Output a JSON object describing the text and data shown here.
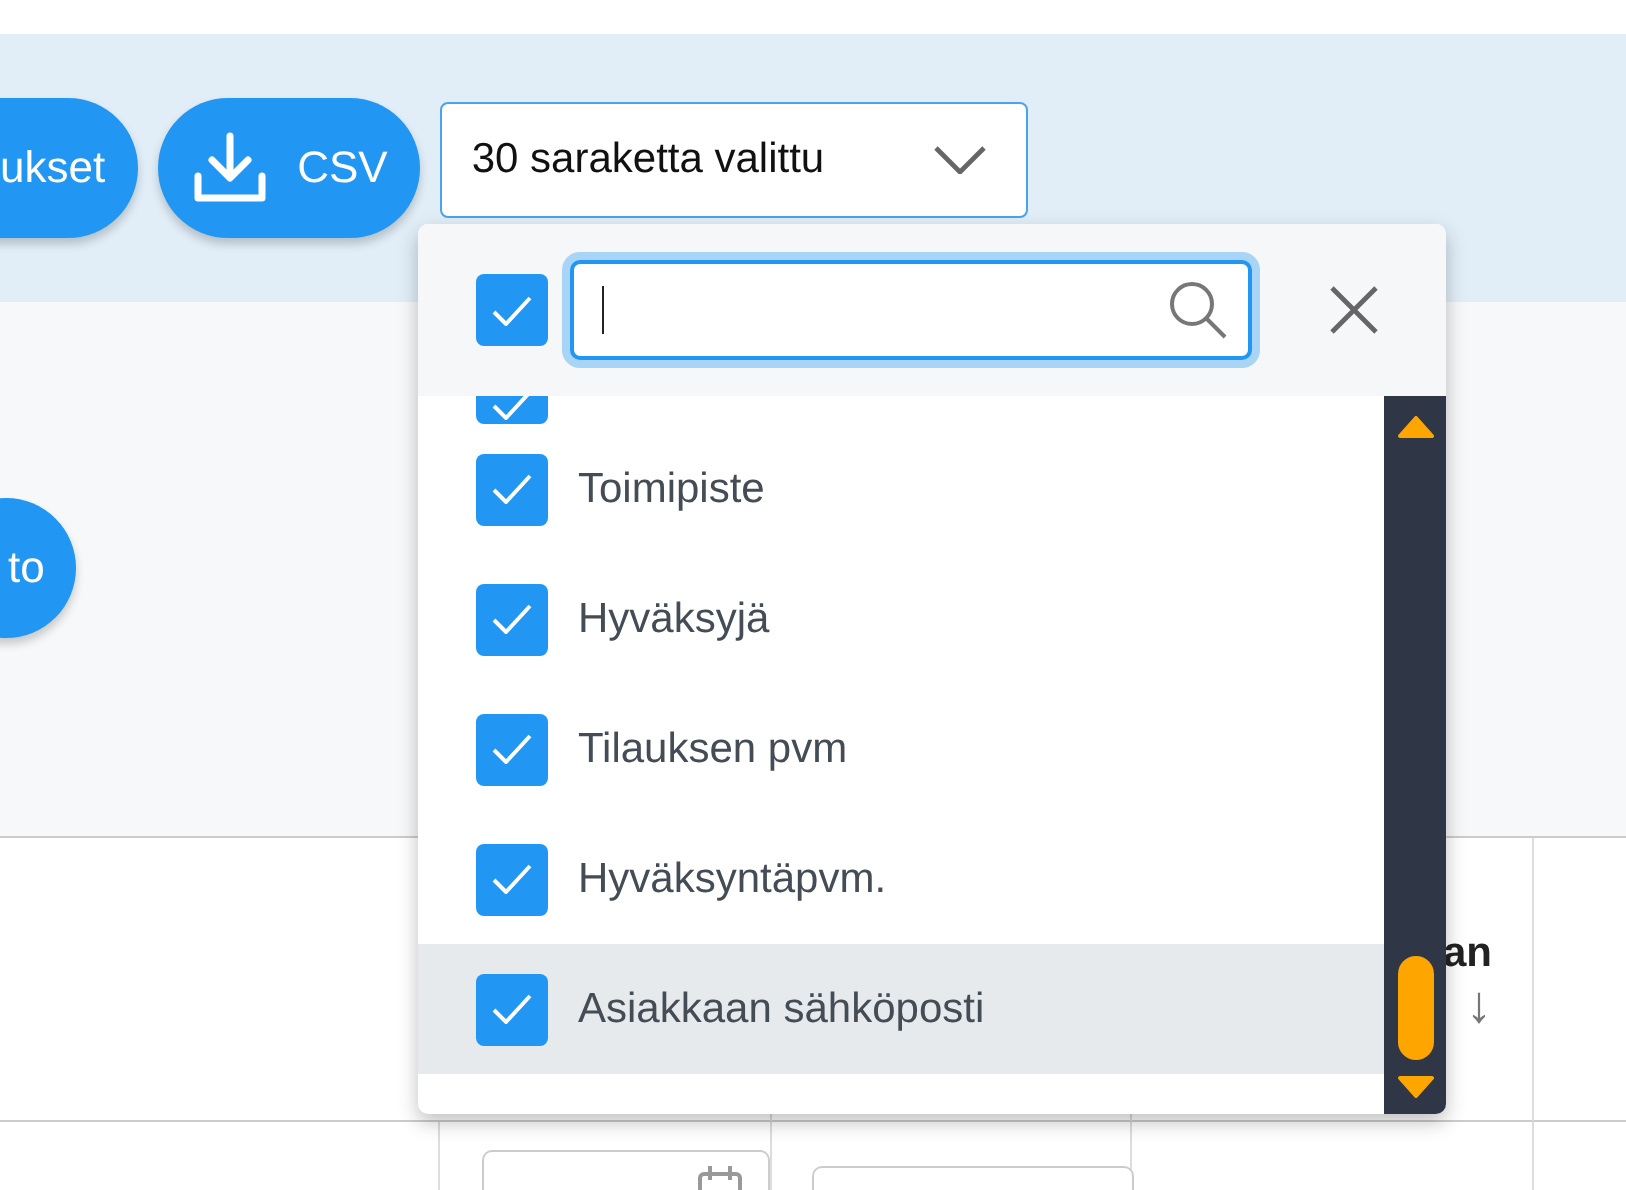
{
  "toolbar": {
    "buttons": [
      {
        "label": "ukset",
        "kind": "text"
      },
      {
        "label": "CSV",
        "kind": "download"
      }
    ],
    "column_select": {
      "value": "30 saraketta valittu",
      "expanded": true
    }
  },
  "side_button": {
    "label": "to"
  },
  "column_picker": {
    "select_all": {
      "checked": true
    },
    "clipped_item": {
      "checked": true
    },
    "items": [
      {
        "label": "Toimipiste",
        "checked": true,
        "selected": false
      },
      {
        "label": "Hyväksyjä",
        "checked": true,
        "selected": false
      },
      {
        "label": "Tilauksen pvm",
        "checked": true,
        "selected": false
      },
      {
        "label": "Hyväksyntäpvm.",
        "checked": true,
        "selected": false
      },
      {
        "label": "Asiakkaan sähköposti",
        "checked": true,
        "selected": true
      }
    ]
  },
  "table": {
    "column_4": {
      "label": "an",
      "sort_icon": "↓"
    }
  }
}
